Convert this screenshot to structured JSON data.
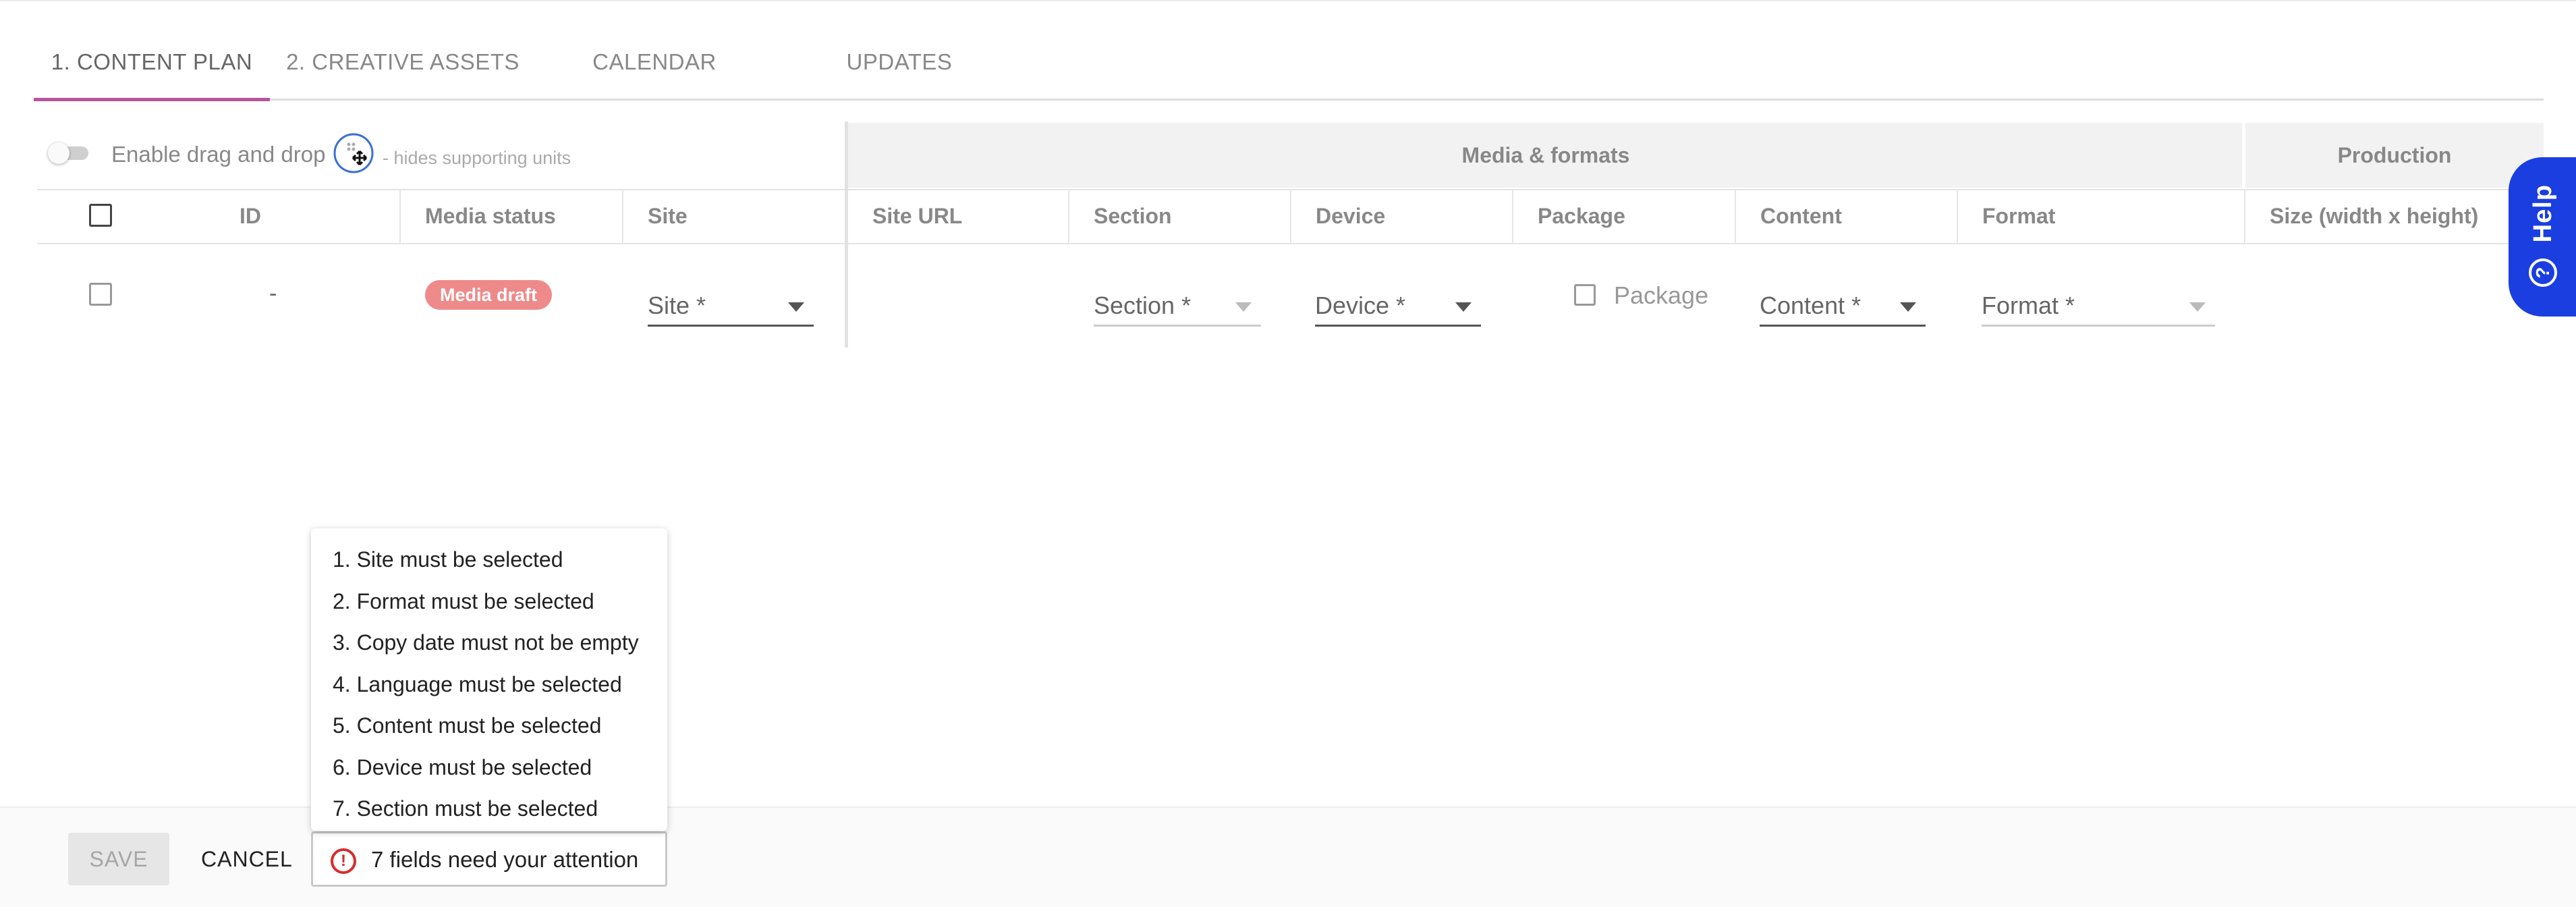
{
  "tabs": [
    {
      "label": "1. CONTENT PLAN",
      "active": true
    },
    {
      "label": "2. CREATIVE ASSETS",
      "active": false
    },
    {
      "label": "CALENDAR",
      "active": false
    },
    {
      "label": "UPDATES",
      "active": false
    }
  ],
  "toolbar": {
    "dnd_label": "Enable drag and drop",
    "dnd_enabled": false,
    "hint": "- hides supporting units",
    "move_icon": "move-icon"
  },
  "groups": {
    "media_formats": "Media & formats",
    "production": "Production"
  },
  "columns": {
    "id": "ID",
    "media_status": "Media status",
    "site": "Site",
    "site_url": "Site URL",
    "section": "Section",
    "device": "Device",
    "package": "Package",
    "content": "Content",
    "format": "Format",
    "size": "Size (width x height)"
  },
  "row": {
    "id": "-",
    "status": "Media draft",
    "site_placeholder": "Site *",
    "section_placeholder": "Section *",
    "device_placeholder": "Device *",
    "package_label": "Package",
    "content_placeholder": "Content *",
    "format_placeholder": "Format *"
  },
  "help": {
    "label": "Help",
    "icon": "?"
  },
  "footer": {
    "save": "SAVE",
    "cancel": "CANCEL",
    "attention": "7 fields need your attention",
    "error_icon": "!"
  },
  "errors": [
    "1. Site must be selected",
    "2. Format must be selected",
    "3. Copy date must not be empty",
    "4. Language must be selected",
    "5. Content must be selected",
    "6. Device must be selected",
    "7. Section must be selected"
  ],
  "colors": {
    "accent_tab": "#b5559a",
    "badge": "#ef8a8a",
    "help_bg": "#1a3ee0",
    "error": "#d62c2c"
  }
}
